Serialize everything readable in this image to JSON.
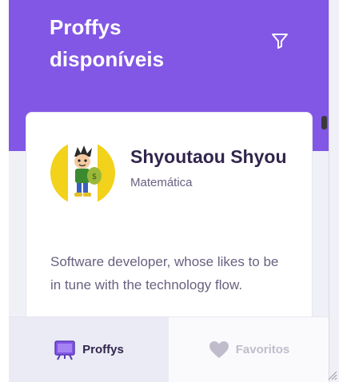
{
  "header": {
    "title": "Proffys\ndisponíveis",
    "filter_icon": "filter-icon"
  },
  "teacher": {
    "name": "Shyoutaou Shyou",
    "subject": "Matemática",
    "bio": "Software developer, whose likes to be in tune with the technology flow.",
    "avatar_icon": "teacher-avatar-cartoon"
  },
  "tabs": [
    {
      "label": "Proffys",
      "icon": "tv-icon",
      "active": true
    },
    {
      "label": "Favoritos",
      "icon": "heart-icon",
      "active": false
    }
  ],
  "colors": {
    "brand_purple": "#8257e5",
    "title_text": "#32264d",
    "body_text": "#6a6180",
    "inactive_tab": "#c1bccc"
  }
}
